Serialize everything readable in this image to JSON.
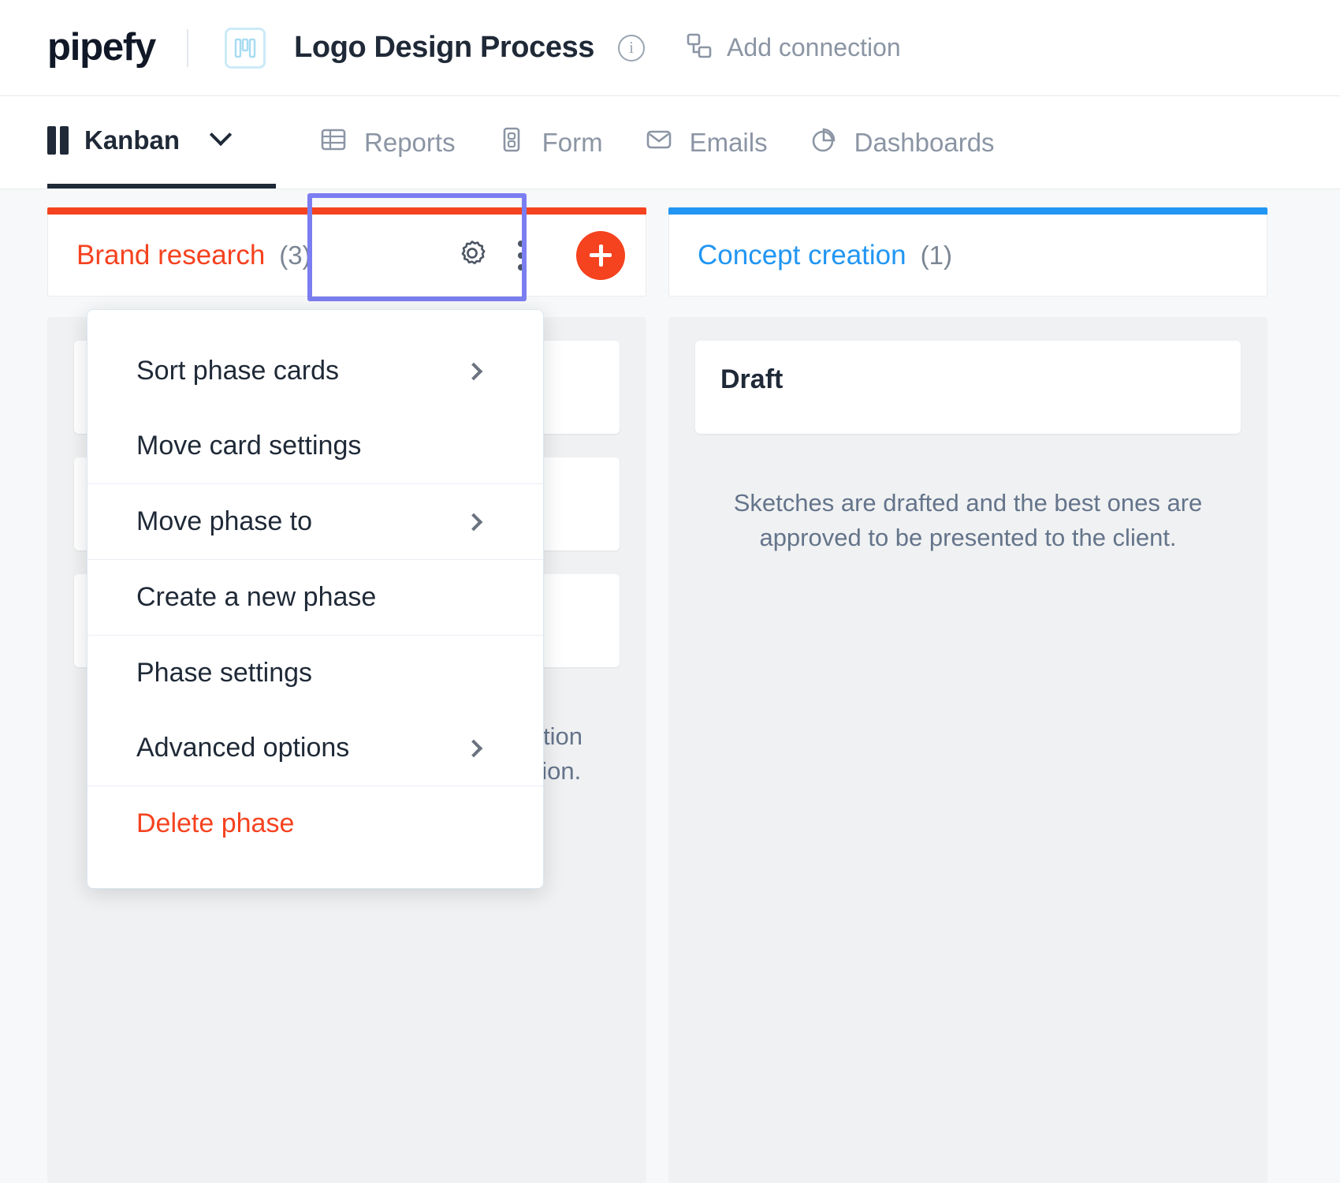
{
  "header": {
    "brand": "pipefy",
    "process_icon_name": "kanban-process-icon",
    "process_title": "Logo Design Process",
    "info_icon": "i",
    "add_connection_label": "Add connection"
  },
  "nav": {
    "tabs": [
      {
        "label": "Kanban",
        "icon": "kanban-icon",
        "active": true,
        "has_caret": true
      },
      {
        "label": "Reports",
        "icon": "table-icon",
        "active": false
      },
      {
        "label": "Form",
        "icon": "form-icon",
        "active": false
      },
      {
        "label": "Emails",
        "icon": "envelope-icon",
        "active": false
      },
      {
        "label": "Dashboards",
        "icon": "pie-chart-icon",
        "active": false
      }
    ]
  },
  "board": {
    "columns": [
      {
        "name": "Brand research",
        "count": "(3)",
        "accent": "#f5421f",
        "description": "client, should gather all relevant information about the company for the logo conception.",
        "cards": []
      },
      {
        "name": "Concept creation",
        "count": "(1)",
        "accent": "#2196f3",
        "description": "Sketches are drafted and the best ones are approved to be presented to the client.",
        "cards": [
          {
            "title": "Draft"
          }
        ]
      }
    ]
  },
  "phase_menu": {
    "groups": [
      {
        "items": [
          {
            "label": "Sort phase cards",
            "submenu": true,
            "danger": false
          },
          {
            "label": "Move card settings",
            "submenu": false,
            "danger": false
          }
        ]
      },
      {
        "items": [
          {
            "label": "Move phase to",
            "submenu": true,
            "danger": false
          }
        ]
      },
      {
        "items": [
          {
            "label": "Create a new phase",
            "submenu": false,
            "danger": false
          }
        ]
      },
      {
        "items": [
          {
            "label": "Phase settings",
            "submenu": false,
            "danger": false
          },
          {
            "label": "Advanced options",
            "submenu": true,
            "danger": false
          }
        ]
      },
      {
        "items": [
          {
            "label": "Delete phase",
            "submenu": false,
            "danger": true
          }
        ]
      }
    ]
  },
  "colors": {
    "brand_orange": "#f5421f",
    "blue_phase": "#2196f3",
    "highlight_purple": "#7b7ef0",
    "text_dark": "#1f2937",
    "text_muted": "#8b95a4"
  }
}
